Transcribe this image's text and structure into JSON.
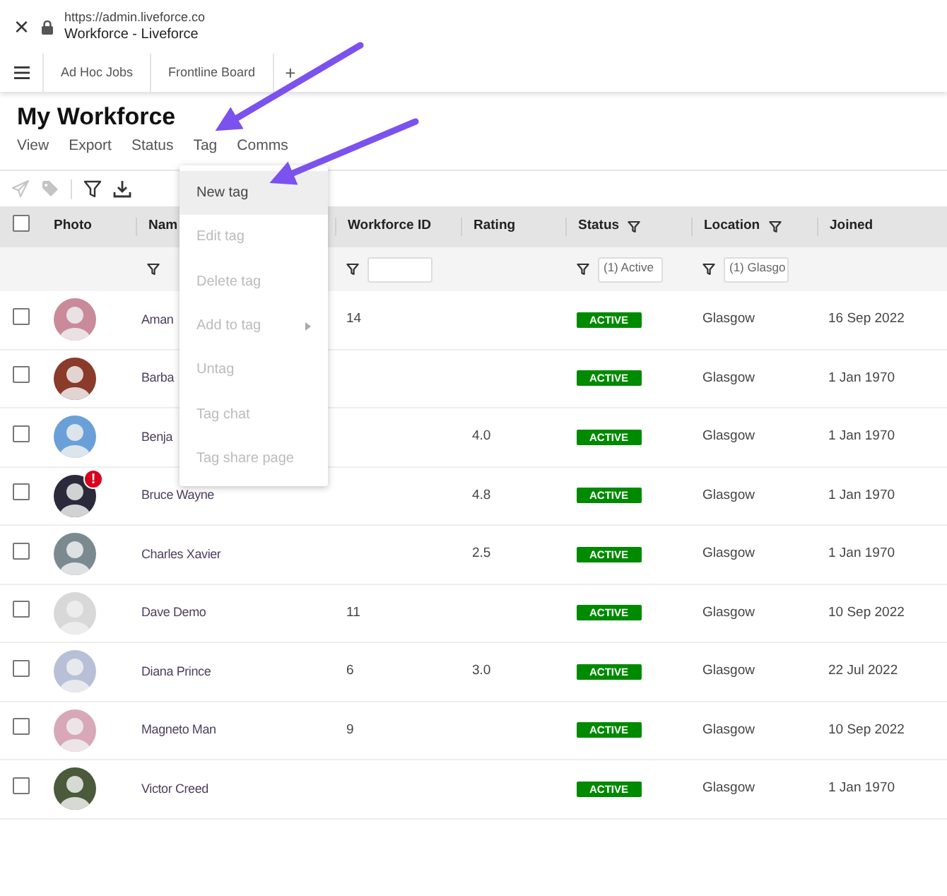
{
  "browser": {
    "close": "×",
    "url": "https://admin.liveforce.co",
    "title": "Workforce - Liveforce"
  },
  "app_tabs": [
    {
      "label": "Ad Hoc Jobs"
    },
    {
      "label": "Frontline Board"
    }
  ],
  "new_tab": "+",
  "page_title": "My Workforce",
  "menu": [
    {
      "label": "View"
    },
    {
      "label": "Export"
    },
    {
      "label": "Status"
    },
    {
      "label": "Tag"
    },
    {
      "label": "Comms"
    }
  ],
  "toolbar": [
    {
      "kind": "send",
      "disabled": true
    },
    {
      "kind": "tag",
      "disabled": true
    },
    {
      "kind": "divider"
    },
    {
      "kind": "filter",
      "disabled": false
    },
    {
      "kind": "download",
      "disabled": false
    }
  ],
  "table": {
    "select_all_checked": false,
    "columns": [
      {
        "label": "Photo",
        "filter": false
      },
      {
        "label": "Nam"
      },
      {
        "label": "Workforce ID",
        "filter": false
      },
      {
        "label": "Rating",
        "filter": false
      },
      {
        "label": "Status",
        "filter": true
      },
      {
        "label": "Location",
        "filter": true
      },
      {
        "label": "Joined",
        "filter": false
      }
    ],
    "filter_row": [
      {
        "kind": "none"
      },
      {
        "kind": "icon"
      },
      {
        "kind": "icon-input"
      },
      {
        "kind": "none"
      },
      {
        "kind": "icon-input",
        "value": "(1) Active"
      },
      {
        "kind": "icon-input",
        "value": "(1) Glasgo"
      },
      {
        "kind": "none"
      }
    ],
    "rows": [
      {
        "checked": false,
        "name": "Aman",
        "workforce_id": "14",
        "status": "ACTIVE",
        "location": "Glasgow",
        "joined": "16 Sep 2022"
      },
      {
        "checked": false,
        "name": "Barba",
        "status": "ACTIVE",
        "location": "Glasgow",
        "joined": "1 Jan 1970"
      },
      {
        "checked": false,
        "name": "Benja",
        "rating": "4.0",
        "status": "ACTIVE",
        "location": "Glasgow",
        "joined": "1 Jan 1970"
      },
      {
        "checked": false,
        "name": "Bruce Wayne",
        "alert": "!",
        "rating": "4.8",
        "status": "ACTIVE",
        "location": "Glasgow",
        "joined": "1 Jan 1970"
      },
      {
        "checked": false,
        "name": "Charles Xavier",
        "rating": "2.5",
        "status": "ACTIVE",
        "location": "Glasgow",
        "joined": "1 Jan 1970"
      },
      {
        "checked": false,
        "name": "Dave Demo",
        "workforce_id": "11",
        "status": "ACTIVE",
        "location": "Glasgow",
        "joined": "10 Sep 2022"
      },
      {
        "checked": false,
        "name": "Diana Prince",
        "workforce_id": "6",
        "rating": "3.0",
        "status": "ACTIVE",
        "location": "Glasgow",
        "joined": "22 Jul 2022"
      },
      {
        "checked": false,
        "name": "Magneto Man",
        "workforce_id": "9",
        "status": "ACTIVE",
        "location": "Glasgow",
        "joined": "10 Sep 2022"
      },
      {
        "checked": false,
        "name": "Victor Creed",
        "status": "ACTIVE",
        "location": "Glasgow",
        "joined": "1 Jan 1970"
      }
    ]
  },
  "dropdown": [
    {
      "label": "New tag",
      "disabled": false,
      "highlighted": true,
      "submenu": false
    },
    {
      "label": "Edit tag",
      "disabled": true,
      "highlighted": false,
      "submenu": false
    },
    {
      "label": "Delete tag",
      "disabled": true,
      "highlighted": false,
      "submenu": false
    },
    {
      "label": "Add to tag",
      "disabled": true,
      "highlighted": false,
      "submenu": true
    },
    {
      "label": "Untag",
      "disabled": true,
      "highlighted": false,
      "submenu": false
    },
    {
      "label": "Tag chat",
      "disabled": true,
      "highlighted": false,
      "submenu": false
    },
    {
      "label": "Tag share page",
      "disabled": true,
      "highlighted": false,
      "submenu": false
    }
  ]
}
